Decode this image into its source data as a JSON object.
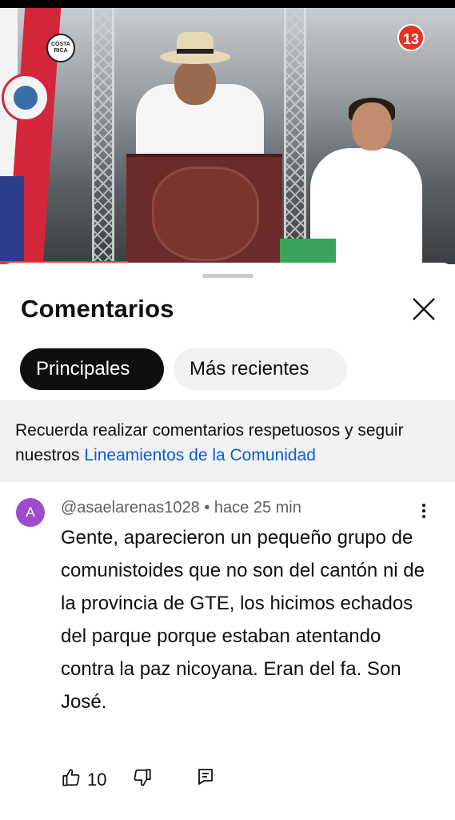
{
  "video": {
    "logo_left_text": "COSTA RICA",
    "logo_right_text": "13",
    "colors": {
      "progress": "#e53935",
      "flag_red": "#d3263a",
      "flag_blue": "#2a3e8c"
    }
  },
  "comments_panel": {
    "title": "Comentarios",
    "close_icon": "close-icon",
    "tabs": [
      {
        "label": "Principales",
        "selected": true
      },
      {
        "label": "Más recientes",
        "selected": false
      }
    ],
    "notice": {
      "text": "Recuerda realizar comentarios respetuosos y seguir nuestros ",
      "link": "Lineamientos de la Comunidad"
    },
    "comments": [
      {
        "avatar_letter": "A",
        "author": "@asaelarenas1028",
        "separator": " • ",
        "time": "hace 25 min",
        "text": "Gente, aparecieron un pequeño grupo de comunistoides que no son del cantón ni de la provincia de GTE, los hicimos echados del parque porque estaban atentando contra la paz nicoyana. Eran del fa. Son José.",
        "likes": "10",
        "icons": [
          "thumbs-up-icon",
          "thumbs-down-icon",
          "reply-icon",
          "more-vert-icon"
        ]
      }
    ],
    "colors": {
      "avatar": "#9c4dcc",
      "link": "#065fd4",
      "chip_active": "#0f0f0f"
    }
  }
}
